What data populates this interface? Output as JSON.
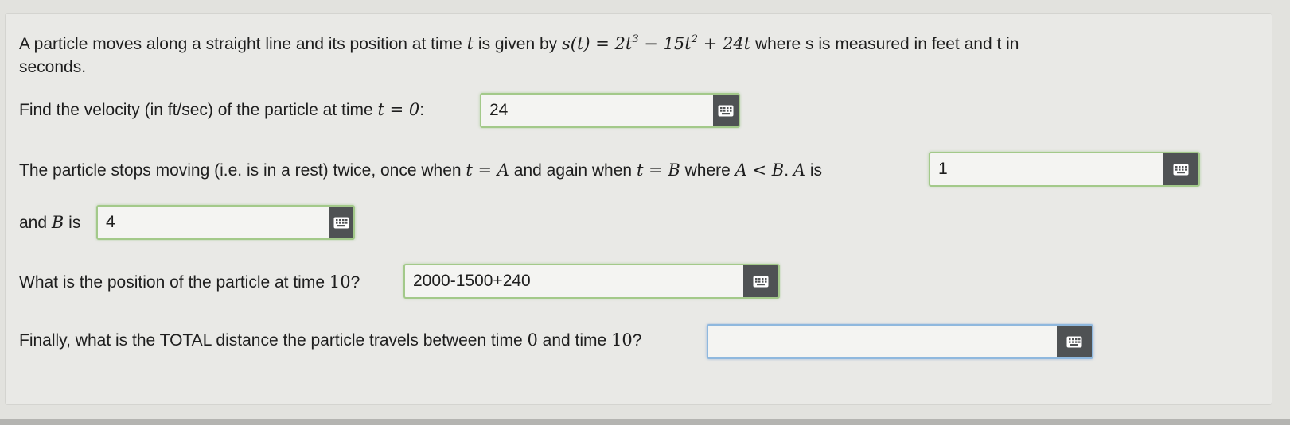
{
  "question": {
    "intro_text_1": "A particle moves along a straight line and its position at time ",
    "intro_t": "t",
    "intro_text_2": " is given by ",
    "formula": {
      "lhs": "s(t) = 2t",
      "exp1": "3",
      "mid": " − 15t",
      "exp2": "2",
      "rhs": " + 24t"
    },
    "intro_text_3": " where s is measured in feet and t in",
    "intro_text_4": "seconds."
  },
  "q1": {
    "text": "Find the velocity (in ft/sec) of the particle at time ",
    "math": "t = 0",
    "colon": ":",
    "answer": "24"
  },
  "q2": {
    "text_1": "The particle stops moving (i.e. is in a rest) twice, once when ",
    "math_1": "t = A",
    "text_2": " and again when ",
    "math_2": "t = B",
    "text_3": " where ",
    "math_3": "A < B",
    "text_4": ". ",
    "math_4": "A",
    "text_5": " is",
    "answer_a": "1",
    "text_6": "and ",
    "math_5": "B",
    "text_7": " is",
    "answer_b": "4"
  },
  "q3": {
    "text": "What is the position of the particle at time ",
    "math": "10",
    "text_2": "?",
    "answer": "2000-1500+240"
  },
  "q4": {
    "text": "Finally, what is the TOTAL distance the particle travels between time ",
    "math_1": "0",
    "text_2": " and time ",
    "math_2": "10",
    "text_3": "?",
    "answer": ""
  },
  "icons": {
    "keypad": "keyboard-icon"
  },
  "colors": {
    "answer_border": "#a3c98a",
    "focus_border": "#8fb8de",
    "keypad_button": "#4f5254"
  }
}
